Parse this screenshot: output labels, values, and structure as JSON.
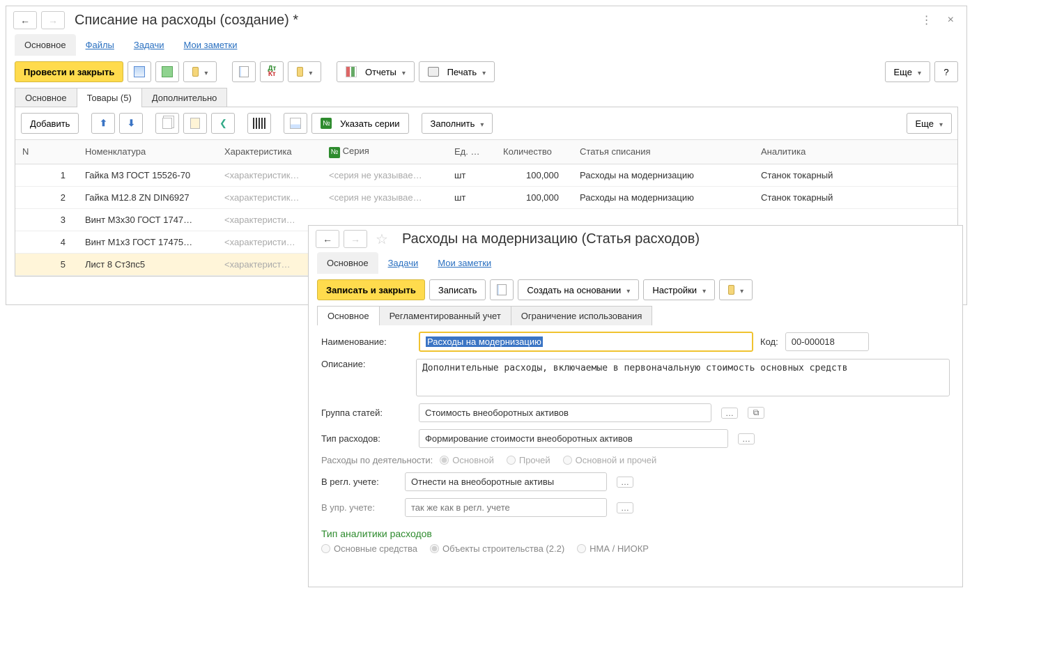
{
  "main": {
    "title": "Списание на расходы (создание) *",
    "pageTabs": [
      "Основное",
      "Файлы",
      "Задачи",
      "Мои заметки"
    ],
    "activePageTab": 0,
    "toolbar": {
      "postClose": "Провести и закрыть",
      "reports": "Отчеты",
      "print": "Печать",
      "more": "Еще",
      "help": "?"
    },
    "formTabs": [
      "Основное",
      "Товары (5)",
      "Дополнительно"
    ],
    "activeFormTab": 1,
    "subToolbar": {
      "add": "Добавить",
      "series": "Указать серии",
      "fill": "Заполнить",
      "more": "Еще"
    },
    "columns": {
      "n": "N",
      "nomen": "Номенклатура",
      "char": "Характеристика",
      "numlbl": "№",
      "series": "Серия",
      "unit": "Ед. …",
      "qty": "Количество",
      "article": "Статья списания",
      "analytics": "Аналитика"
    },
    "placeholders": {
      "char": "<характеристик…",
      "charShort": "<характеристи…",
      "charShorter": "<характерист…",
      "series": "<серия не указывае…"
    },
    "rows": [
      {
        "n": "1",
        "nomen": "Гайка М3 ГОСТ 15526-70",
        "unit": "шт",
        "qty": "100,000",
        "article": "Расходы на модернизацию",
        "analytics": "Станок токарный"
      },
      {
        "n": "2",
        "nomen": "Гайка М12.8 ZN DIN6927",
        "unit": "шт",
        "qty": "100,000",
        "article": "Расходы на модернизацию",
        "analytics": "Станок токарный"
      },
      {
        "n": "3",
        "nomen": "Винт М3х30 ГОСТ 1747…",
        "unit": "",
        "qty": "",
        "article": "",
        "analytics": ""
      },
      {
        "n": "4",
        "nomen": "Винт М1х3 ГОСТ 17475…",
        "unit": "",
        "qty": "",
        "article": "",
        "analytics": ""
      },
      {
        "n": "5",
        "nomen": "Лист 8 Ст3пс5",
        "unit": "",
        "qty": "",
        "article": "",
        "analytics": ""
      }
    ]
  },
  "sub": {
    "title": "Расходы на модернизацию (Статья расходов)",
    "pageTabs": [
      "Основное",
      "Задачи",
      "Мои заметки"
    ],
    "activePageTab": 0,
    "toolbar": {
      "saveClose": "Записать и закрыть",
      "save": "Записать",
      "createBased": "Создать на основании",
      "settings": "Настройки"
    },
    "formTabs": [
      "Основное",
      "Регламентированный учет",
      "Ограничение использования"
    ],
    "activeFormTab": 0,
    "labels": {
      "name": "Наименование:",
      "code": "Код:",
      "desc": "Описание:",
      "group": "Группа статей:",
      "type": "Тип расходов:",
      "activity": "Расходы по деятельности:",
      "regl": "В регл. учете:",
      "mgmt": "В упр. учете:",
      "analyticsType": "Тип аналитики расходов"
    },
    "values": {
      "name": "Расходы на модернизацию",
      "code": "00-000018",
      "desc": "Дополнительные расходы, включаемые в первоначальную стоимость основных средств",
      "group": "Стоимость внеоборотных активов",
      "type": "Формирование стоимости внеоборотных активов",
      "regl": "Отнести на внеоборотные активы",
      "mgmtPlaceholder": "так же как в регл. учете"
    },
    "radios": {
      "activity": [
        "Основной",
        "Прочей",
        "Основной и прочей"
      ],
      "analytics": [
        "Основные средства",
        "Объекты строительства (2.2)",
        "НМА / НИОКР"
      ]
    }
  }
}
